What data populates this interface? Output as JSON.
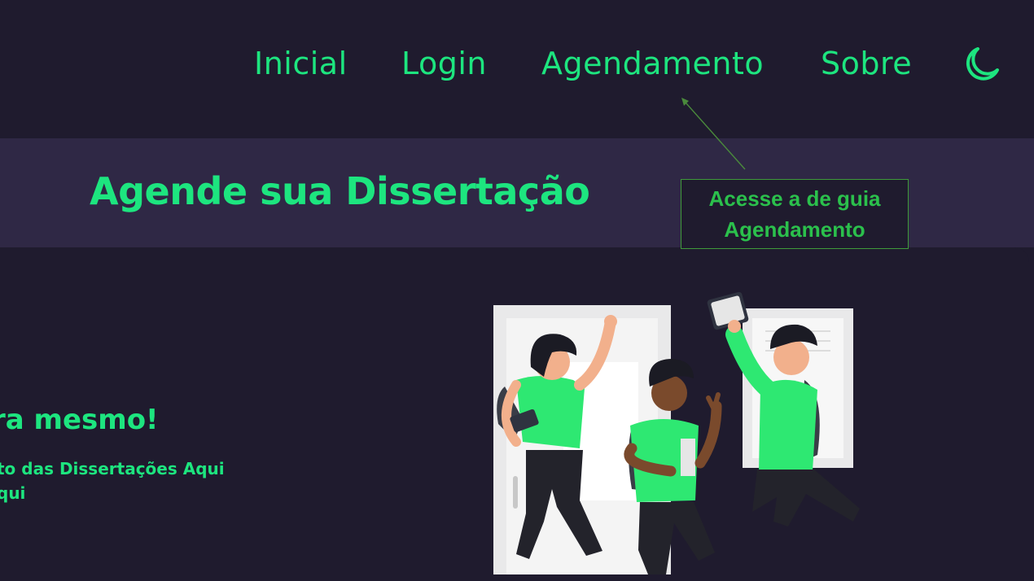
{
  "nav": {
    "items": [
      {
        "label": "Inicial"
      },
      {
        "label": "Login"
      },
      {
        "label": "Agendamento"
      },
      {
        "label": "Sobre"
      }
    ],
    "theme_icon": "moon-icon"
  },
  "page": {
    "title": "Agende sua Dissertação"
  },
  "hero": {
    "heading": "ra mesmo!",
    "line1": "to das Dissertações Aqui",
    "line2": "qui",
    "illustration": "students-jumping-illustration"
  },
  "annotation": {
    "text": "Acesse a de guia Agendamento"
  },
  "colors": {
    "accent": "#1de57f",
    "background": "#1f1b2e",
    "band": "#2f2845",
    "annotation": "#2bc04c"
  }
}
